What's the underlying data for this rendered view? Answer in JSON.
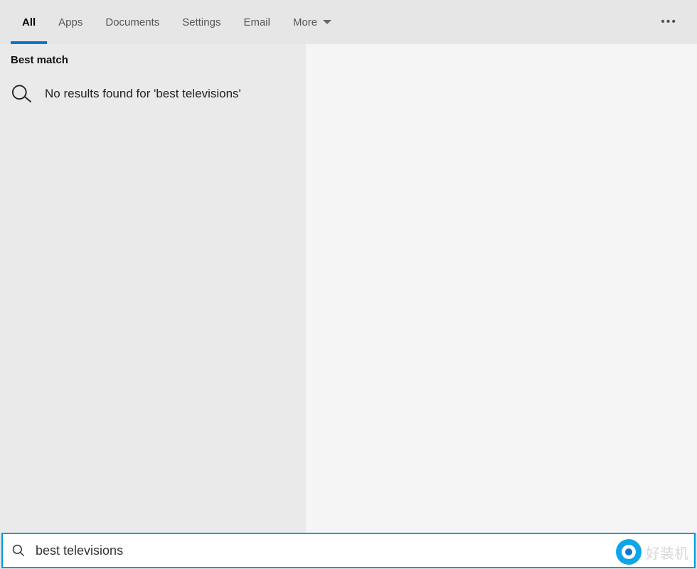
{
  "tabs": {
    "all": "All",
    "apps": "Apps",
    "documents": "Documents",
    "settings": "Settings",
    "email": "Email",
    "more": "More"
  },
  "results": {
    "sectionHeader": "Best match",
    "noResultsText": "No results found for 'best televisions'"
  },
  "search": {
    "value": "best televisions",
    "placeholder": ""
  },
  "watermark": {
    "text": "好装机"
  }
}
